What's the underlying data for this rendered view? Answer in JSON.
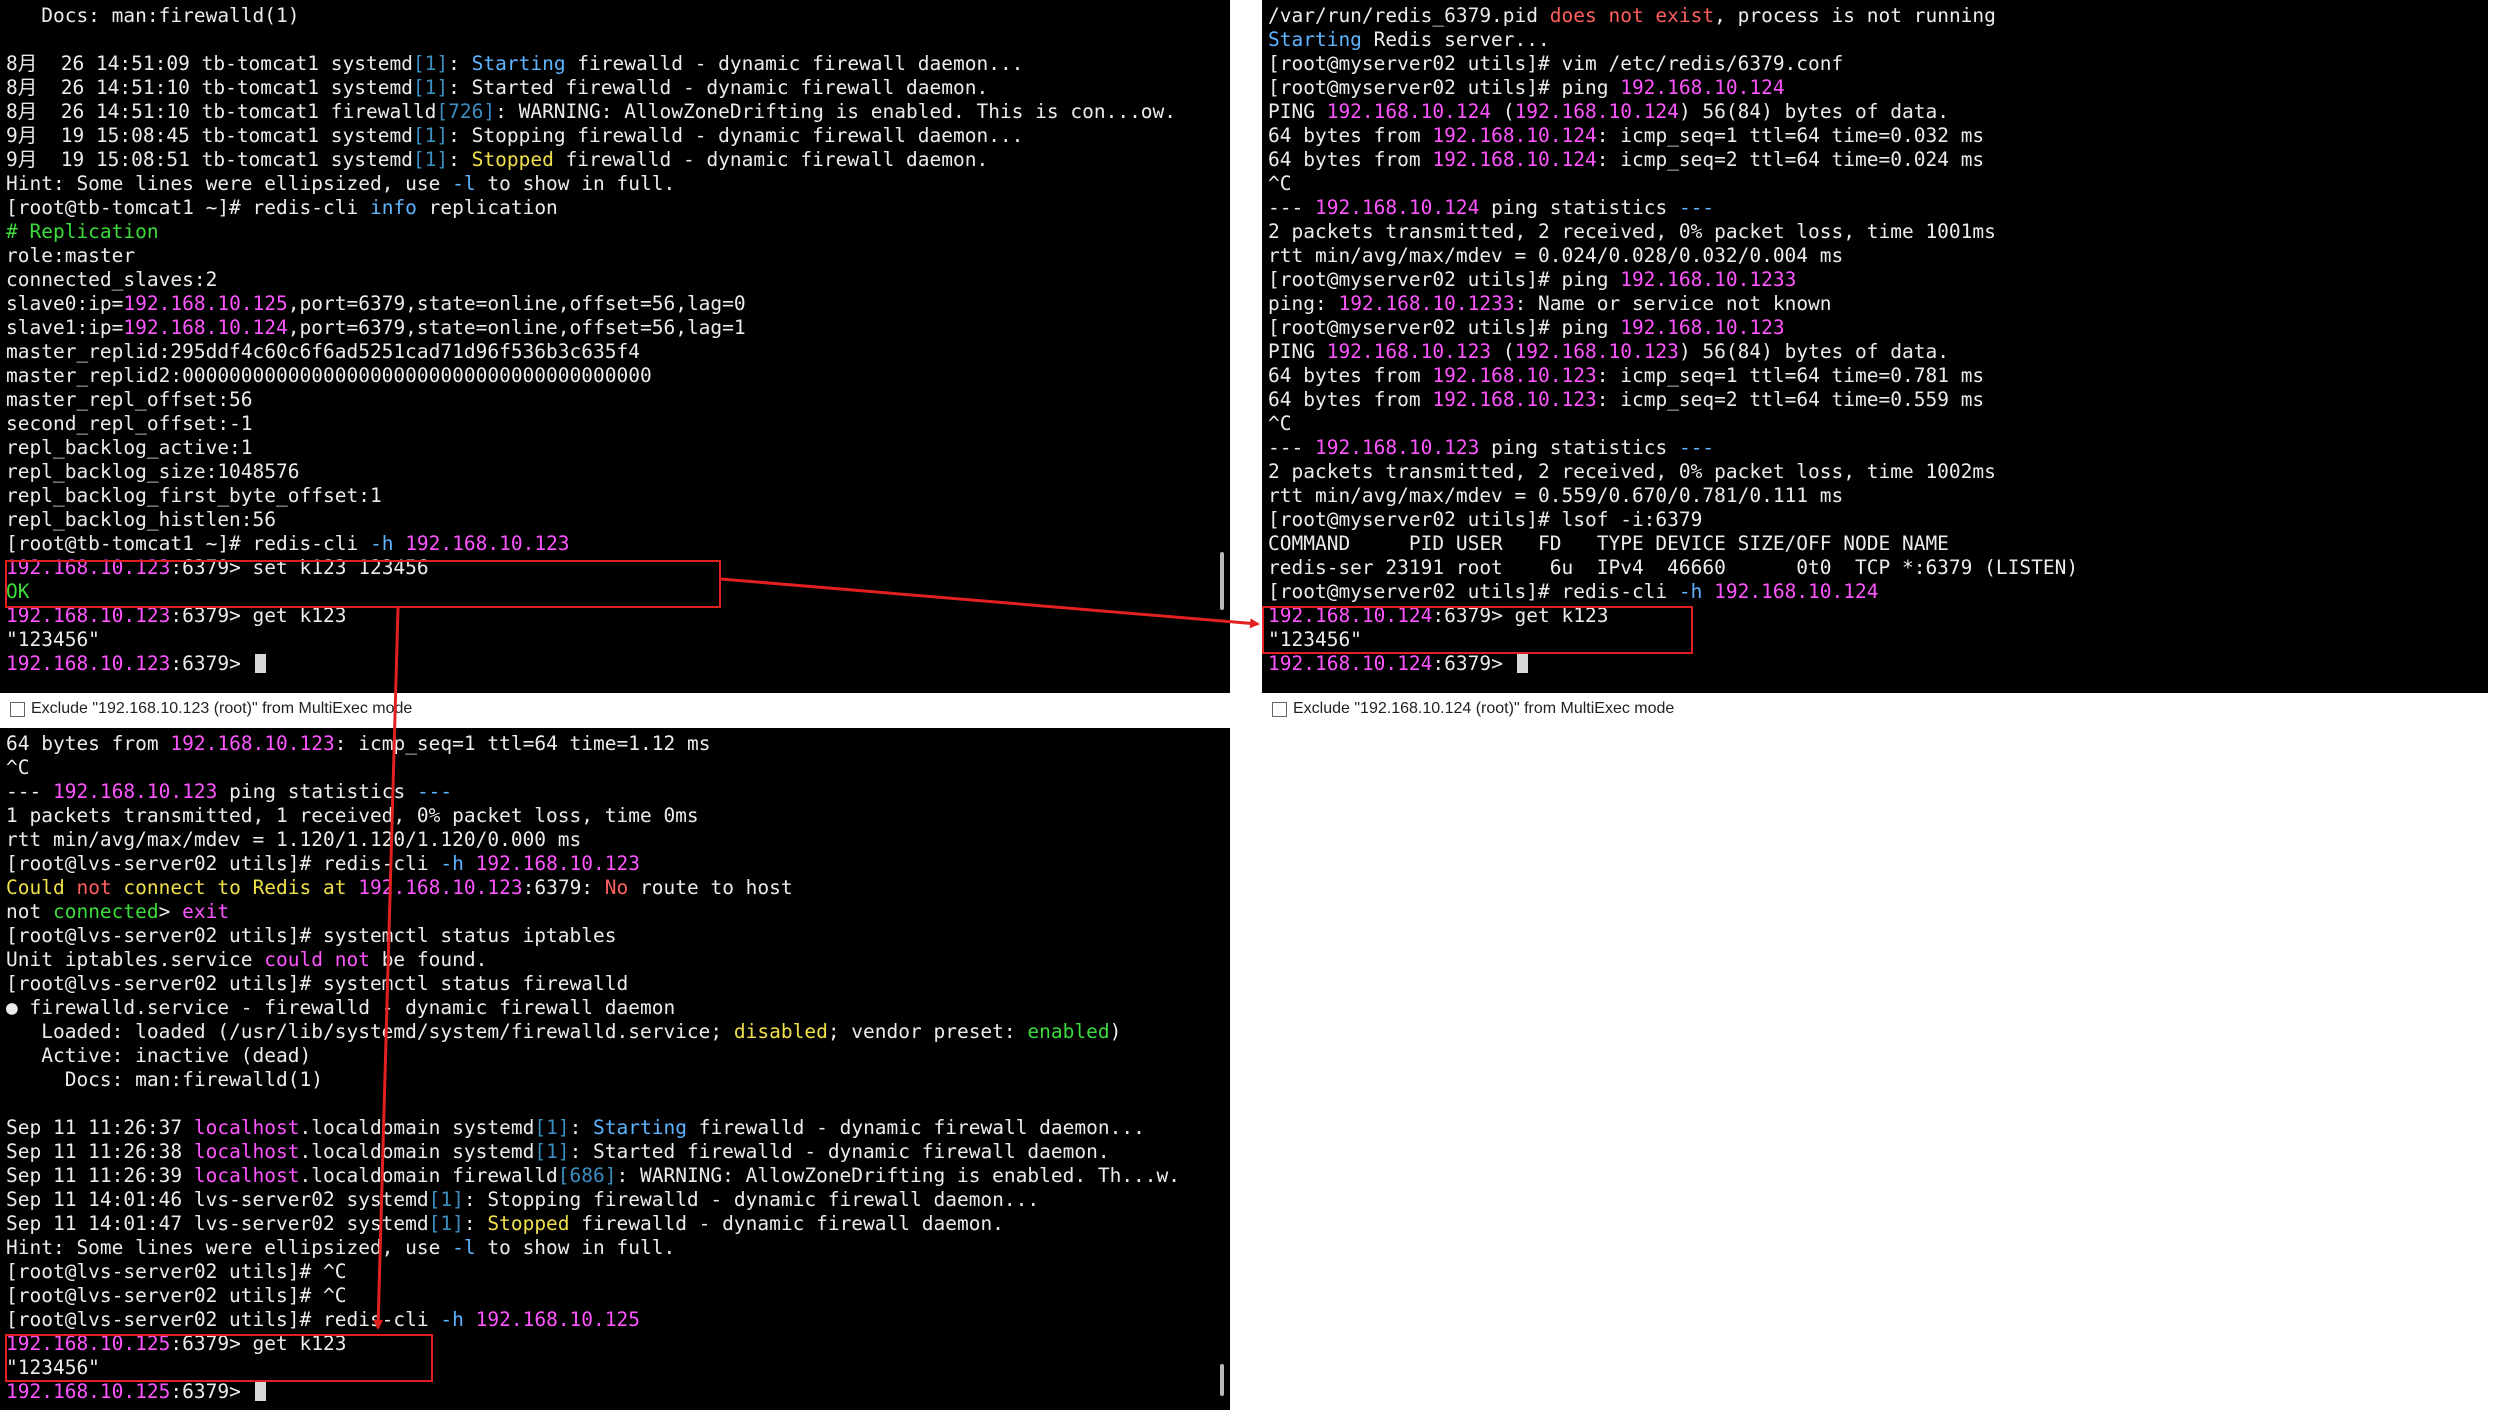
{
  "panes": {
    "top_left": {
      "lines": [
        [
          [
            "   Docs: man:firewalld(1)",
            ""
          ]
        ],
        [
          [
            "",
            ""
          ]
        ],
        [
          [
            "8月  26 14:51:09 tb-tomcat1 systemd",
            ""
          ],
          [
            "[1]",
            "br"
          ],
          [
            ": ",
            ""
          ],
          [
            "Starting",
            "kw"
          ],
          [
            " firewalld - dynamic firewall daemon...",
            ""
          ]
        ],
        [
          [
            "8月  26 14:51:10 tb-tomcat1 systemd",
            ""
          ],
          [
            "[1]",
            "br"
          ],
          [
            ": Started firewalld - dynamic firewall daemon.",
            ""
          ]
        ],
        [
          [
            "8月  26 14:51:10 tb-tomcat1 firewalld",
            ""
          ],
          [
            "[726]",
            "br"
          ],
          [
            ": WARNING: AllowZoneDrifting is enabled. This is con...ow.",
            ""
          ]
        ],
        [
          [
            "9月  19 15:08:45 tb-tomcat1 systemd",
            ""
          ],
          [
            "[1]",
            "br"
          ],
          [
            ": Stopping firewalld - dynamic firewall daemon...",
            ""
          ]
        ],
        [
          [
            "9月  19 15:08:51 tb-tomcat1 systemd",
            ""
          ],
          [
            "[1]",
            "br"
          ],
          [
            ": ",
            ""
          ],
          [
            "Stopped",
            "yellow"
          ],
          [
            " firewalld - dynamic firewall daemon.",
            ""
          ]
        ],
        [
          [
            "Hint: Some lines were ellipsized, use ",
            ""
          ],
          [
            "-l",
            "kw"
          ],
          [
            " to show in full.",
            ""
          ]
        ],
        [
          [
            "[root@tb-tomcat1 ~]# redis-cli ",
            ""
          ],
          [
            "info",
            "kw"
          ],
          [
            " replication",
            ""
          ]
        ],
        [
          [
            "# Replication",
            "green"
          ]
        ],
        [
          [
            "role:master",
            ""
          ]
        ],
        [
          [
            "connected_slaves:2",
            ""
          ]
        ],
        [
          [
            "slave0:ip=",
            ""
          ],
          [
            "192.168.10.125",
            "ip"
          ],
          [
            ",port=6379,state=online,offset=56,lag=0",
            ""
          ]
        ],
        [
          [
            "slave1:ip=",
            ""
          ],
          [
            "192.168.10.124",
            "ip"
          ],
          [
            ",port=6379,state=online,offset=56,lag=1",
            ""
          ]
        ],
        [
          [
            "master_replid:295ddf4c60c6f6ad5251cad71d96f536b3c635f4",
            ""
          ]
        ],
        [
          [
            "master_replid2:0000000000000000000000000000000000000000",
            ""
          ]
        ],
        [
          [
            "master_repl_offset:56",
            ""
          ]
        ],
        [
          [
            "second_repl_offset:-1",
            ""
          ]
        ],
        [
          [
            "repl_backlog_active:1",
            ""
          ]
        ],
        [
          [
            "repl_backlog_size:1048576",
            ""
          ]
        ],
        [
          [
            "repl_backlog_first_byte_offset:1",
            ""
          ]
        ],
        [
          [
            "repl_backlog_histlen:56",
            ""
          ]
        ],
        [
          [
            "[root@tb-tomcat1 ~]# redis-cli ",
            ""
          ],
          [
            "-h",
            "kw"
          ],
          [
            " ",
            ""
          ],
          [
            "192.168.10.123",
            "ip"
          ]
        ],
        [
          [
            "192.168.10.123",
            "ip"
          ],
          [
            ":6379> set k123 123456",
            ""
          ]
        ],
        [
          [
            "OK",
            "green"
          ]
        ],
        [
          [
            "192.168.10.123",
            "ip"
          ],
          [
            ":6379> get k123",
            ""
          ]
        ],
        [
          [
            "\"123456\"",
            ""
          ]
        ],
        [
          [
            "192.168.10.123",
            "ip"
          ],
          [
            ":6379> ",
            ""
          ],
          [
            "",
            "cursor"
          ]
        ]
      ],
      "exclude_label": "Exclude \"192.168.10.123 (root)\" from MultiExec mode"
    },
    "top_right": {
      "lines": [
        [
          [
            "/var/run/redis_6379.pid ",
            ""
          ],
          [
            "does not exist",
            "red"
          ],
          [
            ", process is not running",
            ""
          ]
        ],
        [
          [
            "Starting",
            "kw"
          ],
          [
            " Redis server...",
            ""
          ]
        ],
        [
          [
            "[root@myserver02 utils]# vim /etc/redis/6379.conf",
            ""
          ]
        ],
        [
          [
            "[root@myserver02 utils]# ping ",
            ""
          ],
          [
            "192.168.10.124",
            "ip"
          ]
        ],
        [
          [
            "PING ",
            ""
          ],
          [
            "192.168.10.124",
            "ip"
          ],
          [
            " (",
            ""
          ],
          [
            "192.168.10.124",
            "ip"
          ],
          [
            ") 56(84) bytes of data.",
            ""
          ]
        ],
        [
          [
            "64 bytes from ",
            ""
          ],
          [
            "192.168.10.124",
            "ip"
          ],
          [
            ": icmp_seq=1 ttl=64 time=0.032 ms",
            ""
          ]
        ],
        [
          [
            "64 bytes from ",
            ""
          ],
          [
            "192.168.10.124",
            "ip"
          ],
          [
            ": icmp_seq=2 ttl=64 time=0.024 ms",
            ""
          ]
        ],
        [
          [
            "^C",
            ""
          ]
        ],
        [
          [
            "--- ",
            ""
          ],
          [
            "192.168.10.124",
            "ip"
          ],
          [
            " ping statistics ",
            ""
          ],
          [
            "---",
            "kw"
          ]
        ],
        [
          [
            "2 packets transmitted, 2 received, 0% packet loss, time 1001ms",
            ""
          ]
        ],
        [
          [
            "rtt min/avg/max/mdev = 0.024/0.028/0.032/0.004 ms",
            ""
          ]
        ],
        [
          [
            "[root@myserver02 utils]# ping ",
            ""
          ],
          [
            "192.168.10.1233",
            "ip"
          ]
        ],
        [
          [
            "ping: ",
            ""
          ],
          [
            "192.168.10.1233",
            "ip"
          ],
          [
            ": Name or service not known",
            ""
          ]
        ],
        [
          [
            "[root@myserver02 utils]# ping ",
            ""
          ],
          [
            "192.168.10.123",
            "ip"
          ]
        ],
        [
          [
            "PING ",
            ""
          ],
          [
            "192.168.10.123",
            "ip"
          ],
          [
            " (",
            ""
          ],
          [
            "192.168.10.123",
            "ip"
          ],
          [
            ") 56(84) bytes of data.",
            ""
          ]
        ],
        [
          [
            "64 bytes from ",
            ""
          ],
          [
            "192.168.10.123",
            "ip"
          ],
          [
            ": icmp_seq=1 ttl=64 time=0.781 ms",
            ""
          ]
        ],
        [
          [
            "64 bytes from ",
            ""
          ],
          [
            "192.168.10.123",
            "ip"
          ],
          [
            ": icmp_seq=2 ttl=64 time=0.559 ms",
            ""
          ]
        ],
        [
          [
            "^C",
            ""
          ]
        ],
        [
          [
            "--- ",
            ""
          ],
          [
            "192.168.10.123",
            "ip"
          ],
          [
            " ping statistics ",
            ""
          ],
          [
            "---",
            "kw"
          ]
        ],
        [
          [
            "2 packets transmitted, 2 received, 0% packet loss, time 1002ms",
            ""
          ]
        ],
        [
          [
            "rtt min/avg/max/mdev = 0.559/0.670/0.781/0.111 ms",
            ""
          ]
        ],
        [
          [
            "[root@myserver02 utils]# lsof -i:6379",
            ""
          ]
        ],
        [
          [
            "COMMAND     PID USER   FD   TYPE DEVICE SIZE/OFF NODE NAME",
            ""
          ]
        ],
        [
          [
            "redis-ser 23191 root    6u  IPv4  46660      0t0  TCP *:6379 (LISTEN)",
            ""
          ]
        ],
        [
          [
            "[root@myserver02 utils]# redis-cli ",
            ""
          ],
          [
            "-h",
            "kw"
          ],
          [
            " ",
            ""
          ],
          [
            "192.168.10.124",
            "ip"
          ]
        ],
        [
          [
            "192.168.10.124",
            "ip"
          ],
          [
            ":6379> get k123",
            ""
          ]
        ],
        [
          [
            "\"123456\"",
            ""
          ]
        ],
        [
          [
            "192.168.10.124",
            "ip"
          ],
          [
            ":6379> ",
            ""
          ],
          [
            "",
            "cursor"
          ]
        ]
      ],
      "exclude_label": "Exclude \"192.168.10.124 (root)\" from MultiExec mode"
    },
    "bottom_left": {
      "lines": [
        [
          [
            "64 bytes from ",
            ""
          ],
          [
            "192.168.10.123",
            "ip"
          ],
          [
            ": icmp_seq=1 ttl=64 time=1.12 ms",
            ""
          ]
        ],
        [
          [
            "^C",
            ""
          ]
        ],
        [
          [
            "--- ",
            ""
          ],
          [
            "192.168.10.123",
            "ip"
          ],
          [
            " ping statistics ",
            ""
          ],
          [
            "---",
            "kw"
          ]
        ],
        [
          [
            "1 packets transmitted, 1 received, 0% packet loss, time 0ms",
            ""
          ]
        ],
        [
          [
            "rtt min/avg/max/mdev = 1.120/1.120/1.120/0.000 ms",
            ""
          ]
        ],
        [
          [
            "[root@lvs-server02 utils]# redis-cli ",
            ""
          ],
          [
            "-h",
            "kw"
          ],
          [
            " ",
            ""
          ],
          [
            "192.168.10.123",
            "ip"
          ]
        ],
        [
          [
            "Could ",
            "yellow"
          ],
          [
            "not",
            "red"
          ],
          [
            " connect to Redis at ",
            "yellow"
          ],
          [
            "192.168.10.123",
            "ip"
          ],
          [
            ":6379: ",
            ""
          ],
          [
            "No",
            "red"
          ],
          [
            " route to host",
            ""
          ]
        ],
        [
          [
            "not ",
            ""
          ],
          [
            "connected",
            "green"
          ],
          [
            "> ",
            ""
          ],
          [
            "exit",
            "ip"
          ]
        ],
        [
          [
            "[root@lvs-server02 utils]# systemctl status iptables",
            ""
          ]
        ],
        [
          [
            "Unit iptables.service ",
            ""
          ],
          [
            "could not",
            "ip"
          ],
          [
            " be found.",
            ""
          ]
        ],
        [
          [
            "[root@lvs-server02 utils]# systemctl status firewalld",
            ""
          ]
        ],
        [
          [
            "● firewalld.service - firewalld - dynamic firewall daemon",
            ""
          ]
        ],
        [
          [
            "   Loaded: loaded (/usr/lib/systemd/system/firewalld.service; ",
            ""
          ],
          [
            "disabled",
            "yellow"
          ],
          [
            "; vendor preset: ",
            ""
          ],
          [
            "enabled",
            "green"
          ],
          [
            ")",
            ""
          ]
        ],
        [
          [
            "   Active: inactive (dead)",
            ""
          ]
        ],
        [
          [
            "     Docs: man:firewalld(1)",
            ""
          ]
        ],
        [
          [
            "",
            ""
          ]
        ],
        [
          [
            "Sep 11 11:26:37 ",
            ""
          ],
          [
            "localhost",
            "ip"
          ],
          [
            ".localdomain systemd",
            ""
          ],
          [
            "[1]",
            "br"
          ],
          [
            ": ",
            ""
          ],
          [
            "Starting",
            "kw"
          ],
          [
            " firewalld - dynamic firewall daemon...",
            ""
          ]
        ],
        [
          [
            "Sep 11 11:26:38 ",
            ""
          ],
          [
            "localhost",
            "ip"
          ],
          [
            ".localdomain systemd",
            ""
          ],
          [
            "[1]",
            "br"
          ],
          [
            ": Started firewalld - dynamic firewall daemon.",
            ""
          ]
        ],
        [
          [
            "Sep 11 11:26:39 ",
            ""
          ],
          [
            "localhost",
            "ip"
          ],
          [
            ".localdomain firewalld",
            ""
          ],
          [
            "[686]",
            "br"
          ],
          [
            ": WARNING: AllowZoneDrifting is enabled. Th...w.",
            ""
          ]
        ],
        [
          [
            "Sep 11 14:01:46 lvs-server02 systemd",
            ""
          ],
          [
            "[1]",
            "br"
          ],
          [
            ": Stopping firewalld - dynamic firewall daemon...",
            ""
          ]
        ],
        [
          [
            "Sep 11 14:01:47 lvs-server02 systemd",
            ""
          ],
          [
            "[1]",
            "br"
          ],
          [
            ": ",
            ""
          ],
          [
            "Stopped",
            "yellow"
          ],
          [
            " firewalld - dynamic firewall daemon.",
            ""
          ]
        ],
        [
          [
            "Hint: Some lines were ellipsized, use ",
            ""
          ],
          [
            "-l",
            "kw"
          ],
          [
            " to show in full.",
            ""
          ]
        ],
        [
          [
            "[root@lvs-server02 utils]# ^C",
            ""
          ]
        ],
        [
          [
            "[root@lvs-server02 utils]# ^C",
            ""
          ]
        ],
        [
          [
            "[root@lvs-server02 utils]# redis-cli ",
            ""
          ],
          [
            "-h",
            "kw"
          ],
          [
            " ",
            ""
          ],
          [
            "192.168.10.125",
            "ip"
          ]
        ],
        [
          [
            "192.168.10.125",
            "ip"
          ],
          [
            ":6379> get k123",
            ""
          ]
        ],
        [
          [
            "\"123456\"",
            ""
          ]
        ],
        [
          [
            "192.168.10.125",
            "ip"
          ],
          [
            ":6379> ",
            ""
          ],
          [
            "",
            "cursor"
          ]
        ]
      ]
    }
  },
  "colors": {
    "ip": "#ff55ff",
    "keyword": "#5fb4ff",
    "bracket": "#3c8ec0",
    "error": "#ff5f5f",
    "ok": "#3cdc3c",
    "warn": "#f0e14a",
    "annotation": "#e32020"
  }
}
